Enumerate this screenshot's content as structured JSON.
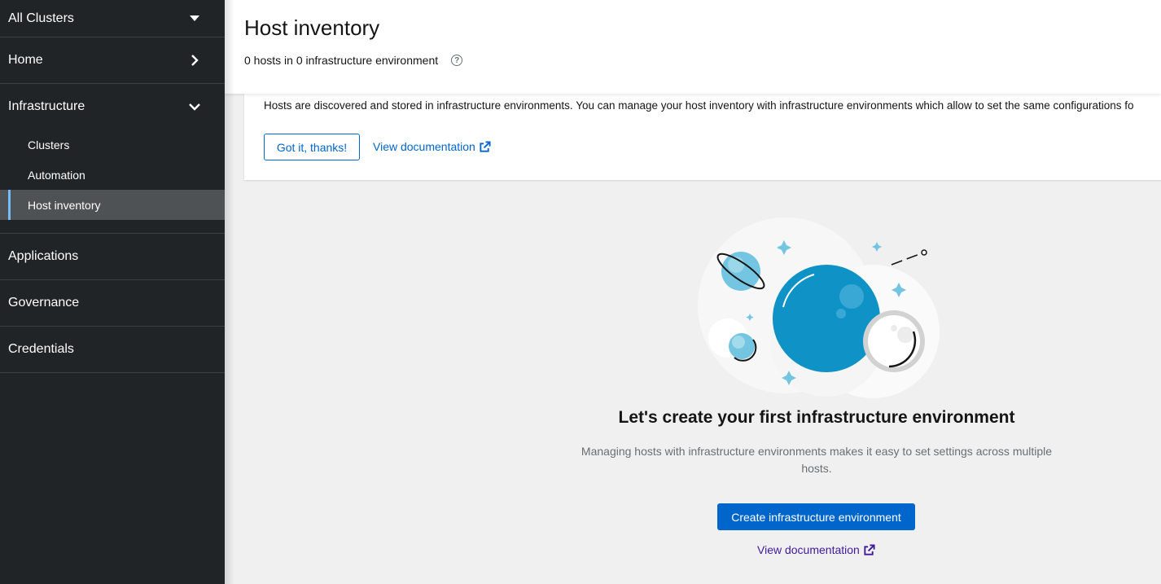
{
  "sidebar": {
    "cluster_switcher": "All Clusters",
    "home": "Home",
    "infrastructure": "Infrastructure",
    "infrastructure_items": [
      {
        "label": "Clusters"
      },
      {
        "label": "Automation"
      },
      {
        "label": "Host inventory",
        "active": true
      }
    ],
    "applications": "Applications",
    "governance": "Governance",
    "credentials": "Credentials"
  },
  "header": {
    "title": "Host inventory",
    "subtitle": "0 hosts in 0 infrastructure environment"
  },
  "alert": {
    "text": "Hosts are discovered and stored in infrastructure environments. You can manage your host inventory with infrastructure environments which allow to set the same configurations fo",
    "dismiss_label": "Got it, thanks!",
    "doc_link": "View documentation"
  },
  "empty_state": {
    "title": "Let's create your first infrastructure environment",
    "body": "Managing hosts with infrastructure environments makes it easy to set settings across multiple hosts.",
    "create_button": "Create infrastructure environment",
    "doc_link": "View documentation"
  },
  "colors": {
    "sidebar_bg": "#212427",
    "primary": "#0066cc",
    "visited_link": "#40199a",
    "active_indicator": "#73bcf7"
  }
}
